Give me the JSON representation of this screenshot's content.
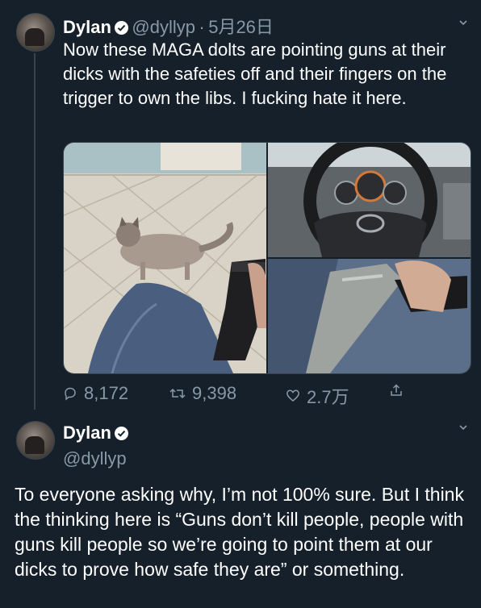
{
  "tweet1": {
    "name": "Dylan",
    "handle": "@dyllyp",
    "separator": "·",
    "date": "5月26日",
    "text": "Now these MAGA dolts are pointing guns at their dicks with the safeties off and their fingers on the trigger to own the libs. I fucking hate it here.",
    "actions": {
      "replies": "8,172",
      "retweets": "9,398",
      "likes": "2.7万"
    }
  },
  "tweet2": {
    "name": "Dylan",
    "handle": "@dyllyp",
    "text": "To everyone asking why, I’m not 100% sure. But I think the thinking here is “Guns don’t kill people, people with guns kill people so we’re going to point them at our dicks to prove how safe they are” or something."
  },
  "icons": {
    "verified": "verified-badge-icon",
    "chevron": "chevron-down-icon",
    "reply": "reply-icon",
    "retweet": "retweet-icon",
    "like": "heart-icon",
    "share": "share-icon"
  },
  "colors": {
    "background": "#15202b",
    "secondary_text": "#8899a6",
    "divider": "#38444d"
  }
}
